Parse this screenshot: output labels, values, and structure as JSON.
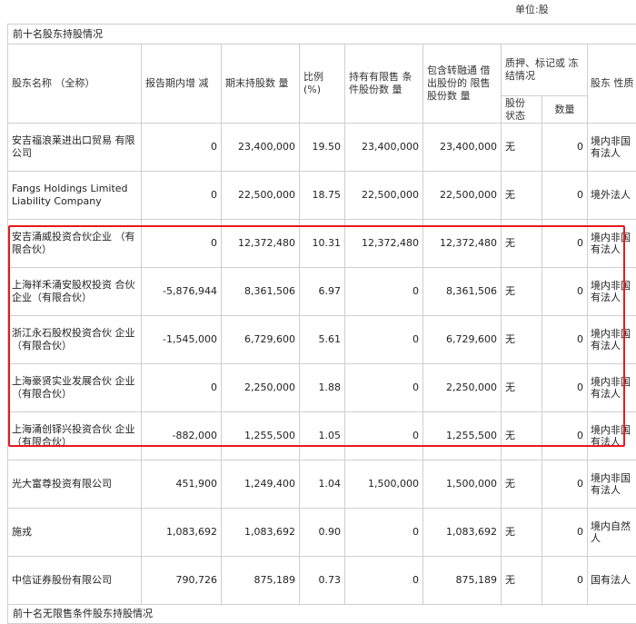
{
  "unit_label": "单位:股",
  "section_title": "前十名股东持股情况",
  "headers": {
    "name": "股东名称 （全称）",
    "change": "报告期内增 减",
    "end_hold": "期末持股数 量",
    "ratio": "比例 (%)",
    "restricted": "持有有限售 条件股份数 量",
    "incl_margin": "包含转融通 借出股份的 限售股份数 量",
    "pledge": "质押、标记或 冻结情况",
    "pledge_status": "股份 状态",
    "pledge_qty": "数量",
    "nature": "股东 性质"
  },
  "rows": [
    {
      "name": "安吉福浪莱进出口贸易 有限公司",
      "change": "0",
      "end_hold": "23,400,000",
      "ratio": "19.50",
      "restricted": "23,400,000",
      "incl_margin": "23,400,000",
      "status": "无",
      "qty": "0",
      "nature": "境内非国有法人"
    },
    {
      "name": "Fangs Holdings Limited Liability Company",
      "change": "0",
      "end_hold": "22,500,000",
      "ratio": "18.75",
      "restricted": "22,500,000",
      "incl_margin": "22,500,000",
      "status": "无",
      "qty": "0",
      "nature": "境外法人"
    },
    {
      "name": "安吉涌威投资合伙企业 （有限合伙）",
      "change": "0",
      "end_hold": "12,372,480",
      "ratio": "10.31",
      "restricted": "12,372,480",
      "incl_margin": "12,372,480",
      "status": "无",
      "qty": "0",
      "nature": "境内非国有法人"
    },
    {
      "name": "上海祥禾涌安股权投资 合伙企业（有限合伙）",
      "change": "-5,876,944",
      "end_hold": "8,361,506",
      "ratio": "6.97",
      "restricted": "0",
      "incl_margin": "8,361,506",
      "status": "无",
      "qty": "0",
      "nature": "境内非国有法人"
    },
    {
      "name": "浙江永石股权投资合伙 企业（有限合伙）",
      "change": "-1,545,000",
      "end_hold": "6,729,600",
      "ratio": "5.61",
      "restricted": "0",
      "incl_margin": "6,729,600",
      "status": "无",
      "qty": "0",
      "nature": "境内非国有法人"
    },
    {
      "name": "上海豪贤实业发展合伙 企业（有限合伙）",
      "change": "0",
      "end_hold": "2,250,000",
      "ratio": "1.88",
      "restricted": "0",
      "incl_margin": "2,250,000",
      "status": "无",
      "qty": "0",
      "nature": "境内非国有法人"
    },
    {
      "name": "上海涌创铎兴投资合伙 企业（有限合伙）",
      "change": "-882,000",
      "end_hold": "1,255,500",
      "ratio": "1.05",
      "restricted": "0",
      "incl_margin": "1,255,500",
      "status": "无",
      "qty": "0",
      "nature": "境内非国有法人"
    },
    {
      "name": "光大富尊投资有限公司",
      "change": "451,900",
      "end_hold": "1,249,400",
      "ratio": "1.04",
      "restricted": "1,500,000",
      "incl_margin": "1,500,000",
      "status": "无",
      "qty": "0",
      "nature": "境内非国有法人"
    },
    {
      "name": "施戎",
      "change": "1,083,692",
      "end_hold": "1,083,692",
      "ratio": "0.90",
      "restricted": "0",
      "incl_margin": "1,083,692",
      "status": "无",
      "qty": "0",
      "nature": "境内自然人"
    },
    {
      "name": "中信证券股份有限公司",
      "change": "790,726",
      "end_hold": "875,189",
      "ratio": "0.73",
      "restricted": "0",
      "incl_margin": "875,189",
      "status": "无",
      "qty": "0",
      "nature": "国有法人"
    }
  ],
  "footer_title": "前十名无限售条件股东持股情况",
  "highlight_color": "#e8191e"
}
